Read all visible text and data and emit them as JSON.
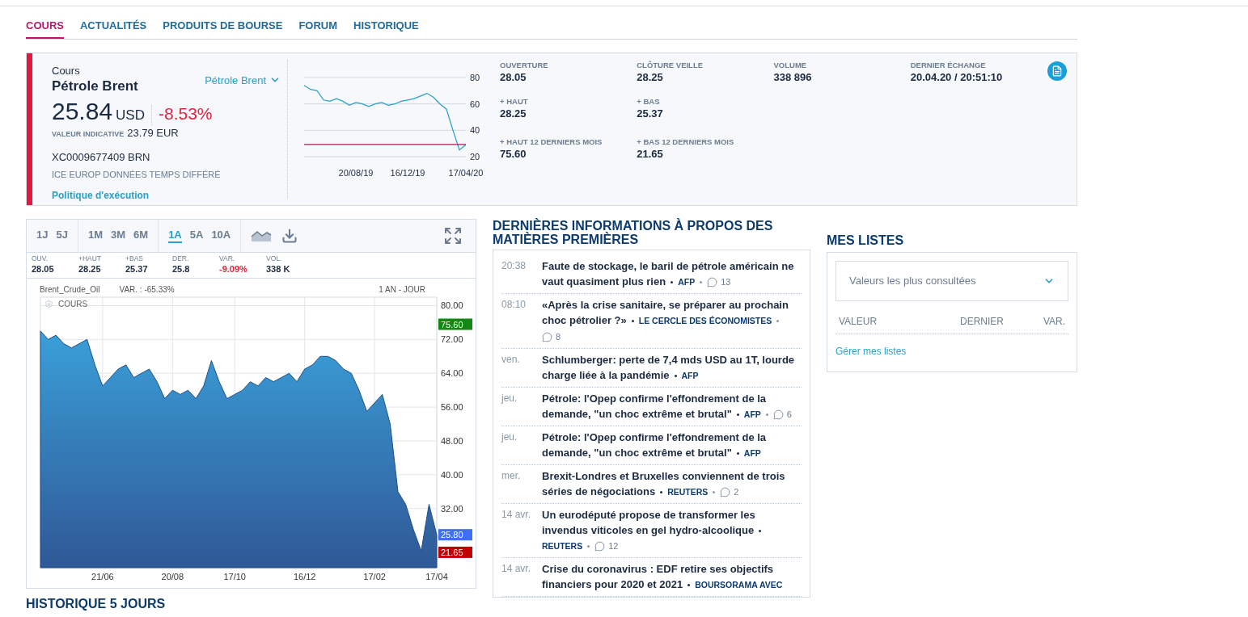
{
  "top_tabs": [
    {
      "label": "COURS",
      "selected": true
    },
    {
      "label": "ACTUALITÉS",
      "selected": false
    },
    {
      "label": "PRODUITS DE BOURSE",
      "selected": false
    },
    {
      "label": "FORUM",
      "selected": false
    },
    {
      "label": "HISTORIQUE",
      "selected": false
    }
  ],
  "quote": {
    "caption": "Cours",
    "name": "Pétrole Brent",
    "selector": "Pétrole Brent",
    "price": "25.84",
    "currency": "USD",
    "change": "-8.53%",
    "negative": true,
    "indicative_label": "VALEUR INDICATIVE",
    "indicative_value": "23.79 EUR",
    "isin": "XC0009677409 BRN",
    "market": "ICE EUROP DONNÉES TEMPS DIFFÉRÉ",
    "policy_link": "Politique d'exécution",
    "mini_chart": {
      "chart_data": {
        "type": "line",
        "categories": [
          null,
          null,
          null,
          null,
          null,
          null,
          null,
          null,
          "20/08/19",
          null,
          null,
          null,
          null,
          null,
          null,
          null,
          "16/12/19",
          null,
          null,
          null,
          null,
          null,
          null,
          null,
          null,
          "17/04/20"
        ],
        "series": [
          {
            "color": "#2aa0c8",
            "values": [
              74,
              71,
              70,
              63,
              62,
              64,
              62,
              59,
              61,
              60,
              58,
              60,
              61,
              59,
              60,
              62,
              63,
              64,
              66,
              68,
              65,
              60,
              56,
              40,
              25,
              29
            ]
          },
          {
            "color": "#a3195b",
            "values": [
              29.3,
              29.3,
              29.3,
              29.3,
              29.3,
              29.3,
              29.3,
              29.3,
              29.3,
              29.3,
              29.3,
              29.3,
              29.3,
              29.3,
              29.3,
              29.3,
              29.3,
              29.3,
              29.3,
              29.3,
              29.3,
              29.3,
              29.3,
              29.3,
              29.3,
              29.3
            ]
          }
        ],
        "ylim": [
          20,
          80
        ],
        "yticks": [
          20,
          40,
          60,
          80
        ],
        "grid": true
      }
    },
    "stats": [
      [
        {
          "label": "OUVERTURE",
          "value": "28.05"
        },
        {
          "label": "CLÔTURE VEILLE",
          "value": "28.25"
        },
        {
          "label": "VOLUME",
          "value": "338 896"
        },
        {
          "label": "DERNIER ÉCHANGE",
          "value": "20.04.20 / 20:51:10"
        }
      ],
      [
        {
          "label": "+ HAUT",
          "value": "28.25"
        },
        {
          "label": "+ BAS",
          "value": "25.37"
        }
      ],
      [
        {
          "label": "+ HAUT 12 DERNIERS MOIS",
          "value": "75.60"
        },
        {
          "label": "+ BAS 12 DERNIERS MOIS",
          "value": "21.65"
        }
      ]
    ]
  },
  "chart_widget": {
    "period_groups": [
      [
        {
          "label": "1J",
          "selected": false
        },
        {
          "label": "5J",
          "selected": false
        }
      ],
      [
        {
          "label": "1M",
          "selected": false
        },
        {
          "label": "3M",
          "selected": false
        },
        {
          "label": "6M",
          "selected": false
        }
      ],
      [
        {
          "label": "1A",
          "selected": true
        },
        {
          "label": "5A",
          "selected": false
        },
        {
          "label": "10A",
          "selected": false
        }
      ]
    ],
    "stats": [
      {
        "label": "OUV.",
        "value": "28.05",
        "negative": false
      },
      {
        "label": "+HAUT",
        "value": "28.25",
        "negative": false
      },
      {
        "label": "+BAS",
        "value": "25.37",
        "negative": false
      },
      {
        "label": "DER.",
        "value": "25.8",
        "negative": false
      },
      {
        "label": "VAR.",
        "value": "-9.09%",
        "negative": true
      },
      {
        "label": "VOL.",
        "value": "338 K",
        "negative": false
      }
    ],
    "variation": "VAR. : -65.33%",
    "range": "1 AN - JOUR",
    "legend": "COURS",
    "price_tags": [
      {
        "label": "75.60",
        "color": "#118811"
      },
      {
        "label": "25.80",
        "color": "#3d6ff0"
      },
      {
        "label": "21.65",
        "color": "#c00000"
      }
    ],
    "chart_data": {
      "type": "area",
      "categories": [
        null,
        null,
        null,
        null,
        null,
        null,
        null,
        null,
        "21/06",
        null,
        null,
        null,
        null,
        null,
        null,
        null,
        null,
        "20/08",
        null,
        null,
        null,
        null,
        null,
        null,
        null,
        "17/10",
        null,
        null,
        null,
        null,
        null,
        null,
        null,
        null,
        "16/12",
        null,
        null,
        null,
        null,
        null,
        null,
        null,
        null,
        "17/02",
        null,
        null,
        null,
        null,
        null,
        null,
        null,
        "17/04"
      ],
      "grid": true,
      "series": [
        {
          "name": "Brent_Crude_Oil",
          "color": "#1d4f8c",
          "values": [
            74,
            72,
            73,
            71,
            70,
            71,
            72,
            66,
            61,
            63,
            65,
            66,
            63,
            64,
            65,
            62,
            58,
            60,
            59,
            60,
            58,
            61,
            67,
            62,
            58,
            59,
            60,
            62,
            61,
            63,
            62,
            63,
            64,
            62,
            65,
            66,
            68,
            68,
            67,
            65,
            64,
            60,
            55,
            57,
            59,
            52,
            36,
            33,
            27,
            22,
            33,
            25.8
          ]
        }
      ],
      "ylim": [
        18,
        82
      ],
      "yticks": [
        {
          "value": 32,
          "label": "32.00"
        },
        {
          "value": 40,
          "label": "40.00"
        },
        {
          "value": 48,
          "label": "48.00"
        },
        {
          "value": 56,
          "label": "56.00"
        },
        {
          "value": 64,
          "label": "64.00"
        },
        {
          "value": 72,
          "label": "72.00"
        },
        {
          "value": 80,
          "label": "80.00"
        }
      ]
    }
  },
  "news": {
    "title": "DERNIÈRES INFORMATIONS À PROPOS DES MATIÈRES PREMIÈRES",
    "items": [
      {
        "time": "20:38",
        "title": "Faute de stockage, le baril de pétrole américain ne vaut quasiment plus rien",
        "source": "AFP",
        "comments": "13"
      },
      {
        "time": "08:10",
        "title": "«Après la crise sanitaire, se préparer au prochain choc pétrolier ?»",
        "source": "LE CERCLE DES ÉCONOMISTES",
        "comments": "8"
      },
      {
        "time": "ven.",
        "title": "Schlumberger: perte de 7,4 mds USD au 1T, lourde charge liée à la pandémie",
        "source": "AFP"
      },
      {
        "time": "jeu.",
        "title": "Pétrole: l'Opep confirme l'effondrement de la demande, \"un choc extrême et brutal\"",
        "source": "AFP",
        "comments": "6"
      },
      {
        "time": "jeu.",
        "title": "Pétrole: l'Opep confirme l'effondrement de la demande, \"un choc extrême et brutal\"",
        "source": "AFP"
      },
      {
        "time": "mer.",
        "title": "Brexit-Londres et Bruxelles conviennent de trois séries de négociations",
        "source": "REUTERS",
        "comments": "2"
      },
      {
        "time": "14 avr.",
        "title": "Un eurodéputé propose de transformer les invendus viticoles en gel hydro-alcoolique",
        "source": "REUTERS",
        "comments": "12"
      },
      {
        "time": "14 avr.",
        "title": "Crise du coronavirus : EDF retire ses objectifs financiers pour 2020 et 2021",
        "source": "BOURSORAMA AVEC"
      }
    ]
  },
  "lists": {
    "title": "MES LISTES",
    "select": "Valeurs les plus consultées",
    "columns": [
      "VALEUR",
      "DERNIER",
      "VAR."
    ],
    "manage_link": "Gérer mes listes"
  },
  "history": {
    "title": "HISTORIQUE 5 JOURS"
  }
}
